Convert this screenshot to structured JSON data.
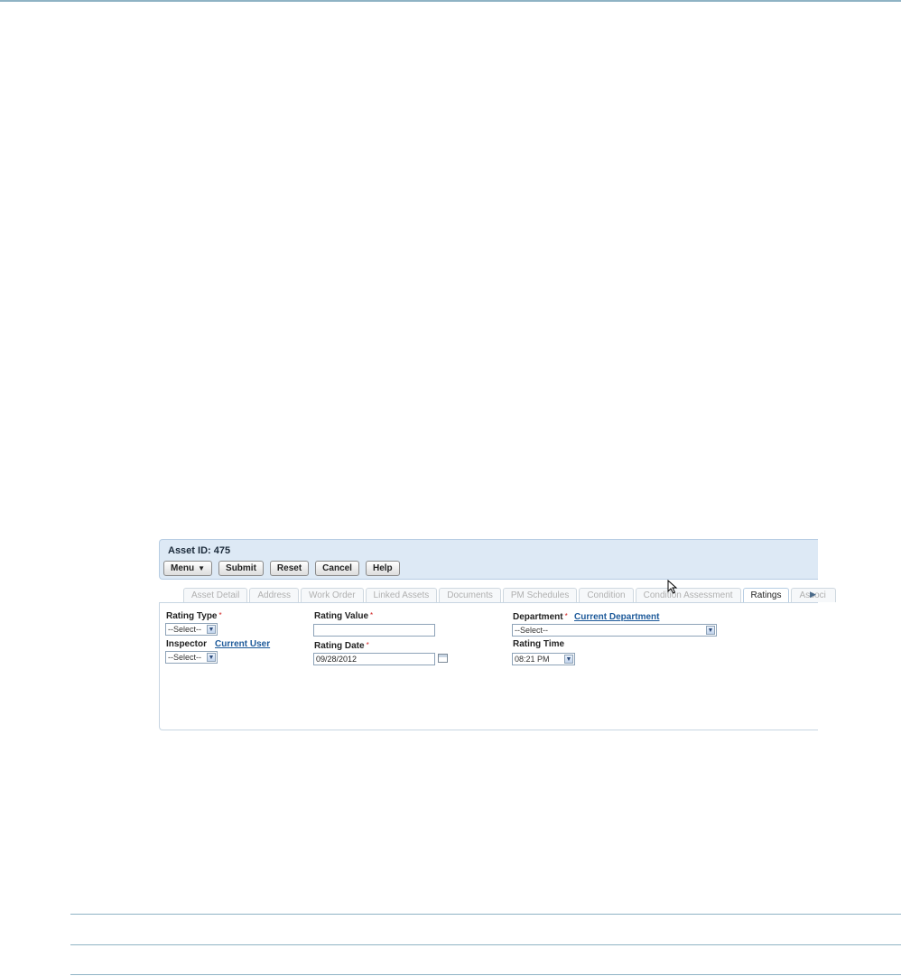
{
  "asset": {
    "title": "Asset ID: 475"
  },
  "toolbar": {
    "menu": "Menu",
    "menu_caret": "▼",
    "submit": "Submit",
    "reset": "Reset",
    "cancel": "Cancel",
    "help": "Help"
  },
  "tabs": [
    "Asset Detail",
    "Address",
    "Work Order",
    "Linked Assets",
    "Documents",
    "PM Schedules",
    "Condition",
    "Condition Assessment",
    "Ratings",
    "Associ"
  ],
  "active_tab": "Ratings",
  "form": {
    "rating_type": {
      "label": "Rating Type",
      "required": "*",
      "value": "--Select--"
    },
    "inspector": {
      "label": "Inspector",
      "link": "Current User",
      "value": "--Select--"
    },
    "rating_value": {
      "label": "Rating Value",
      "required": "*",
      "value": ""
    },
    "rating_date": {
      "label": "Rating Date",
      "required": "*",
      "value": "09/28/2012"
    },
    "department": {
      "label": "Department",
      "required": "*",
      "link": "Current Department",
      "value": "--Select--"
    },
    "rating_time": {
      "label": "Rating Time",
      "value": "08:21 PM"
    }
  },
  "icons": {
    "dropdown": "chevron-down-icon",
    "calendar": "calendar-icon",
    "scroll_tabs": "arrow-right-icon",
    "cursor": "mouse-pointer-icon"
  },
  "colors": {
    "panel_bg": "#dde9f5",
    "link": "#1d5a9a",
    "required": "#d02020",
    "rule": "#8fb3c4"
  }
}
